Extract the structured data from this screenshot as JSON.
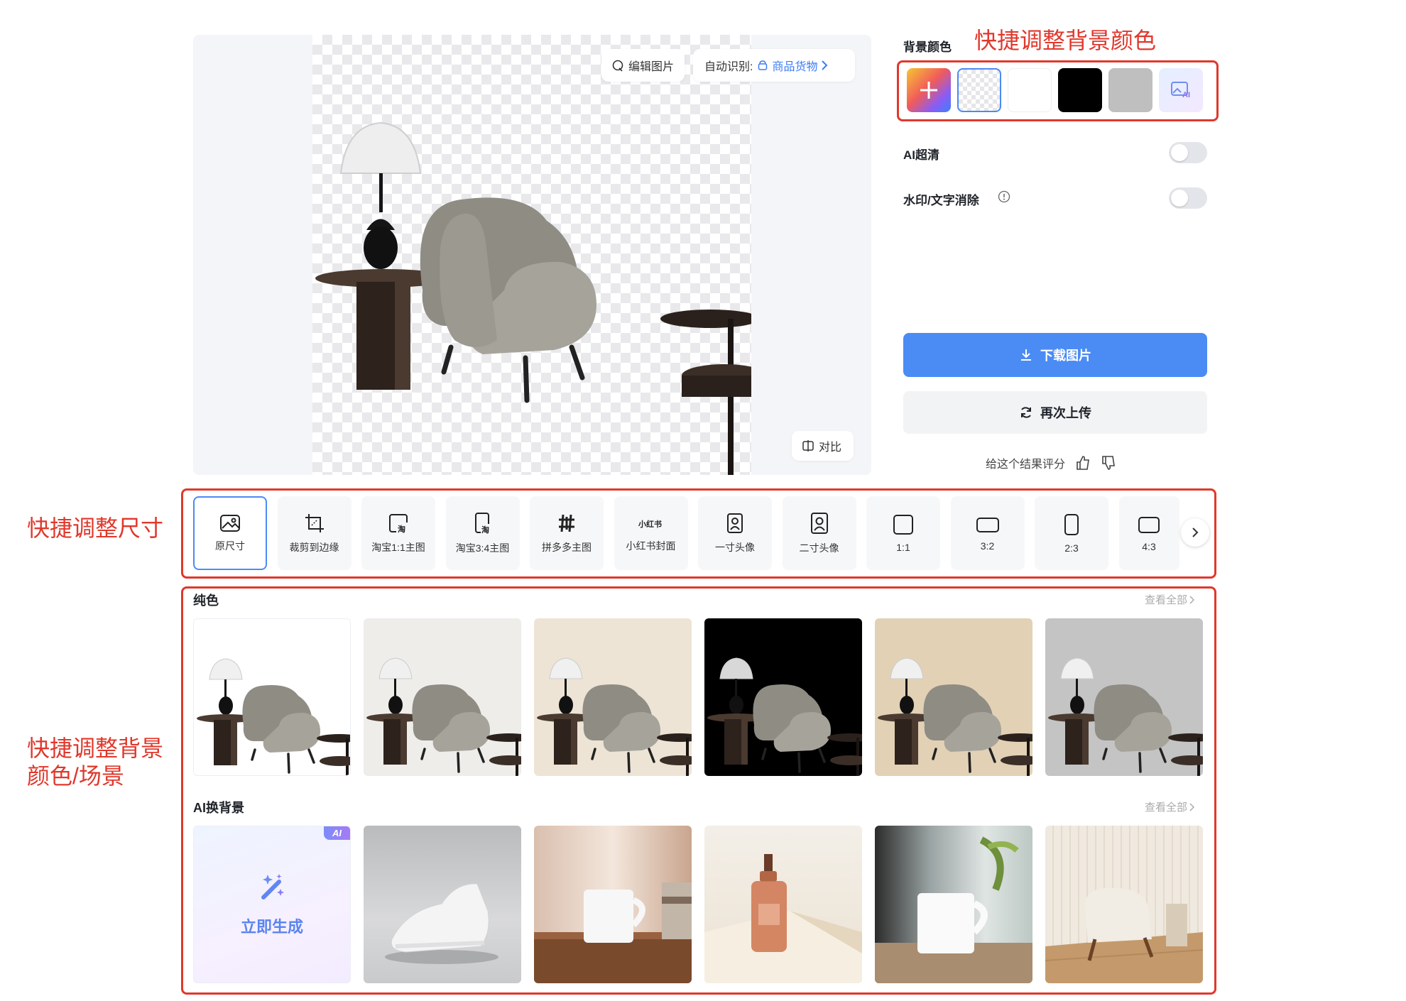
{
  "preview": {
    "edit_label": "编辑图片",
    "auto_label": "自动识别:",
    "auto_value": "商品货物",
    "compare_label": "对比"
  },
  "panel": {
    "bg_label": "背景颜色",
    "bg_note": "快捷调整背景颜色",
    "swatches": [
      {
        "name": "add-custom",
        "color": "gradient"
      },
      {
        "name": "transparent",
        "color": "checker"
      },
      {
        "name": "white",
        "color": "#ffffff"
      },
      {
        "name": "black",
        "color": "#000000"
      },
      {
        "name": "gray",
        "color": "#bfbfbf"
      },
      {
        "name": "ai-background",
        "color": "gradient-light"
      }
    ],
    "ai_hd_label": "AI超清",
    "ai_hd_on": false,
    "watermark_label": "水印/文字消除",
    "watermark_on": false,
    "download_label": "下载图片",
    "reupload_label": "再次上传",
    "rate_label": "给这个结果评分"
  },
  "sizes": {
    "note": "快捷调整尺寸",
    "items": [
      {
        "label": "原尺寸",
        "icon": "image-icon",
        "selected": true
      },
      {
        "label": "裁剪到边缘",
        "icon": "crop-icon",
        "selected": false
      },
      {
        "label": "淘宝1:1主图",
        "icon": "taobao-square-icon",
        "selected": false
      },
      {
        "label": "淘宝3:4主图",
        "icon": "taobao-portrait-icon",
        "selected": false
      },
      {
        "label": "拼多多主图",
        "icon": "pinduoduo-icon",
        "selected": false
      },
      {
        "label": "小红书封面",
        "icon": "xiaohongshu-icon",
        "selected": false,
        "icon_text": "小红书"
      },
      {
        "label": "一寸头像",
        "icon": "portrait-1-icon",
        "selected": false
      },
      {
        "label": "二寸头像",
        "icon": "portrait-2-icon",
        "selected": false
      },
      {
        "label": "1:1",
        "icon": "ratio-1-1-icon",
        "selected": false
      },
      {
        "label": "3:2",
        "icon": "ratio-3-2-icon",
        "selected": false
      },
      {
        "label": "2:3",
        "icon": "ratio-2-3-icon",
        "selected": false
      },
      {
        "label": "4:3",
        "icon": "ratio-4-3-icon",
        "selected": false
      }
    ]
  },
  "scenes": {
    "note_line1": "快捷调整背景",
    "note_line2": "颜色/场景",
    "solid": {
      "title": "纯色",
      "see_all": "查看全部",
      "colors": [
        "#ffffff",
        "#efedea",
        "#ede4d6",
        "#000000",
        "#e2d1b5",
        "#c4c4c4"
      ]
    },
    "ai": {
      "title": "AI换背景",
      "see_all": "查看全部",
      "generate_label": "立即生成",
      "badge": "AI",
      "scenes": [
        "sneaker-scene",
        "mug-table-scene",
        "serum-bottle-scene",
        "mug-window-scene",
        "armchair-room-scene"
      ]
    }
  }
}
